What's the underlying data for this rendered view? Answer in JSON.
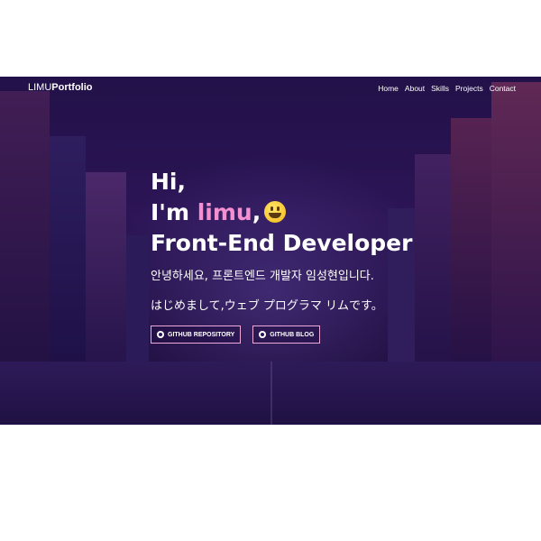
{
  "navbar": {
    "brand_prefix": "LIMU",
    "brand_suffix": "Portfolio",
    "links": [
      "Home",
      "About",
      "Skills",
      "Projects",
      "Contact"
    ]
  },
  "hero": {
    "line1": "Hi,",
    "line2_prefix": "I'm ",
    "line2_name": "limu",
    "line2_suffix": ",",
    "emoji_icon": "grinning-face-icon",
    "line3": "Front-End Developer",
    "subtitle_ko": "안녕하세요, 프론트엔드 개발자 임성현입니다.",
    "subtitle_ja": "はじめまして,ウェブ プログラマ リムです。",
    "buttons": {
      "repo_label": "GITHUB REPOSITORY",
      "blog_label": "GITHUB BLOG"
    }
  },
  "colors": {
    "accent_name": "#f48fd0",
    "button_border": "#f0a8d8",
    "hero_background": "#2a1658"
  }
}
